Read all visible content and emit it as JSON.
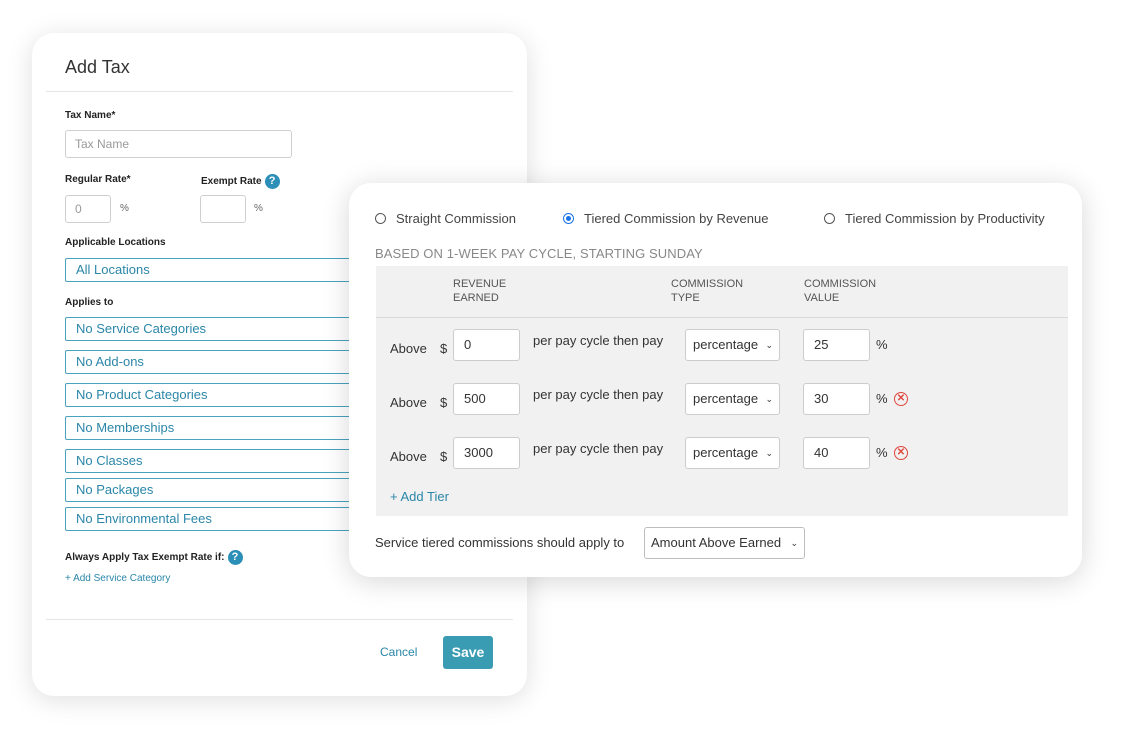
{
  "tax_form": {
    "title": "Add Tax",
    "tax_name_label": "Tax Name*",
    "tax_name_placeholder": "Tax Name",
    "regular_rate_label": "Regular Rate*",
    "regular_rate_value": "0",
    "exempt_rate_label": "Exempt Rate",
    "percent_sign": "%",
    "applicable_locations_label": "Applicable Locations",
    "locations_value": "All Locations",
    "applies_to_label": "Applies to",
    "applies_to": [
      "No Service Categories",
      "No Add-ons",
      "No Product Categories",
      "No Memberships",
      "No Classes",
      "No Packages",
      "No Environmental Fees"
    ],
    "exempt_if_label": "Always Apply Tax Exempt Rate if:",
    "add_service_category": "+ Add Service Category",
    "help_glyph": "?",
    "cancel_label": "Cancel",
    "save_label": "Save"
  },
  "commission": {
    "options": [
      {
        "label": "Straight Commission",
        "selected": false
      },
      {
        "label": "Tiered Commission by Revenue",
        "selected": true
      },
      {
        "label": "Tiered Commission by Productivity",
        "selected": false
      }
    ],
    "cycle_note": "BASED ON 1-WEEK PAY CYCLE, STARTING SUNDAY",
    "headers": {
      "revenue_1": "REVENUE",
      "revenue_2": "EARNED",
      "type_1": "COMMISSION",
      "type_2": "TYPE",
      "value_1": "COMMISSION",
      "value_2": "VALUE"
    },
    "tiers": [
      {
        "above": "Above",
        "currency": "$",
        "amount": "0",
        "per_cycle": "per pay cycle then pay",
        "type": "percentage",
        "value": "25",
        "unit": "%",
        "removable": false
      },
      {
        "above": "Above",
        "currency": "$",
        "amount": "500",
        "per_cycle": "per pay cycle then pay",
        "type": "percentage",
        "value": "30",
        "unit": "%",
        "removable": true
      },
      {
        "above": "Above",
        "currency": "$",
        "amount": "3000",
        "per_cycle": "per pay cycle then pay",
        "type": "percentage",
        "value": "40",
        "unit": "%",
        "removable": true
      }
    ],
    "add_tier_label": "+ Add Tier",
    "apply_label": "Service tiered commissions should apply to",
    "apply_value": "Amount Above Earned",
    "remove_glyph": "✕",
    "chevron_glyph": "⌄"
  }
}
